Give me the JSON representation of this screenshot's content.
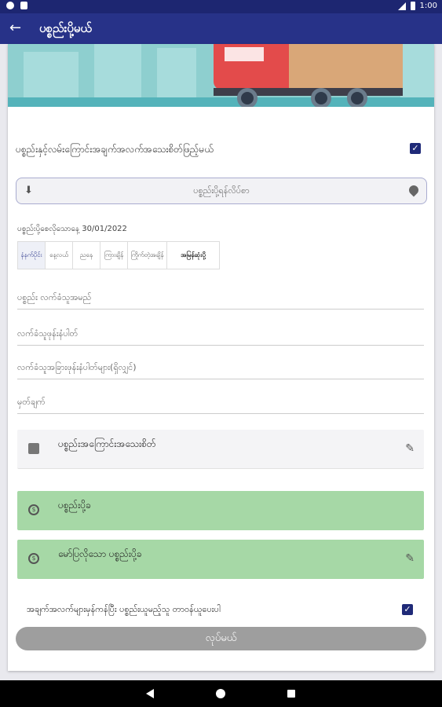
{
  "status_bar": {
    "time": "1:00"
  },
  "app_bar": {
    "title": "ပစ္စည်းပို့မယ်",
    "back_icon": "arrow-back-icon"
  },
  "pickup_info": {
    "label": "ပစ္စည်းနှင့်လမ်းကြောင်းအချက်အလက်အသေးစိတ်ဖြည့်မယ်",
    "checked": true
  },
  "address": {
    "placeholder": "ပစ္စည်းပို့ရန်လိပ်စာ"
  },
  "delivery_date": {
    "label": "ပစ္စည်းပို့စေလိုသောနေ့ 30/01/2022"
  },
  "time_slots": [
    {
      "label": "နံနက်ပိုင်း",
      "selected": true
    },
    {
      "label": "နေ့လယ်",
      "selected": false
    },
    {
      "label": "ညနေ",
      "selected": false
    },
    {
      "label": "ကြားချိန်",
      "selected": false
    },
    {
      "label": "ကြိုက်တဲ့အချိန်",
      "selected": false
    },
    {
      "label": "အမြန်ဆုံးပို့",
      "selected": false
    }
  ],
  "fields": {
    "receiver_name": "ပစ္စည်း လက်ခံသူအမည်",
    "receiver_phone": "လက်ခံသူဖုန်းနံပါတ်",
    "receiver_other_phones": "လက်ခံသူအခြားဖုန်းနံပါတ်များ(ရှိလျှင်)",
    "note": "မှတ်ချက်"
  },
  "item_details": {
    "label": "ပစ္စည်းအကြောင်းအသေးစိတ်",
    "icon": "briefcase-icon"
  },
  "delivery_fee": {
    "label": "ပစ္စည်းပို့ခ",
    "icon": "coin-icon"
  },
  "requested_fee": {
    "label": "မော်ပြလိုသော ပစ္စည်းပို့ခ",
    "icon": "coin-icon"
  },
  "confirm": {
    "label": "အချက်အလက်များမှန်ကန်ပြီး ပစ္စည်းယူမည့်သူ တာဝန်ယူပေးပါ",
    "checked": true
  },
  "submit": {
    "label": "လုပ်မယ်"
  },
  "colors": {
    "primary": "#273288",
    "green": "#a6d8a6",
    "disabled": "#9e9e9e"
  }
}
